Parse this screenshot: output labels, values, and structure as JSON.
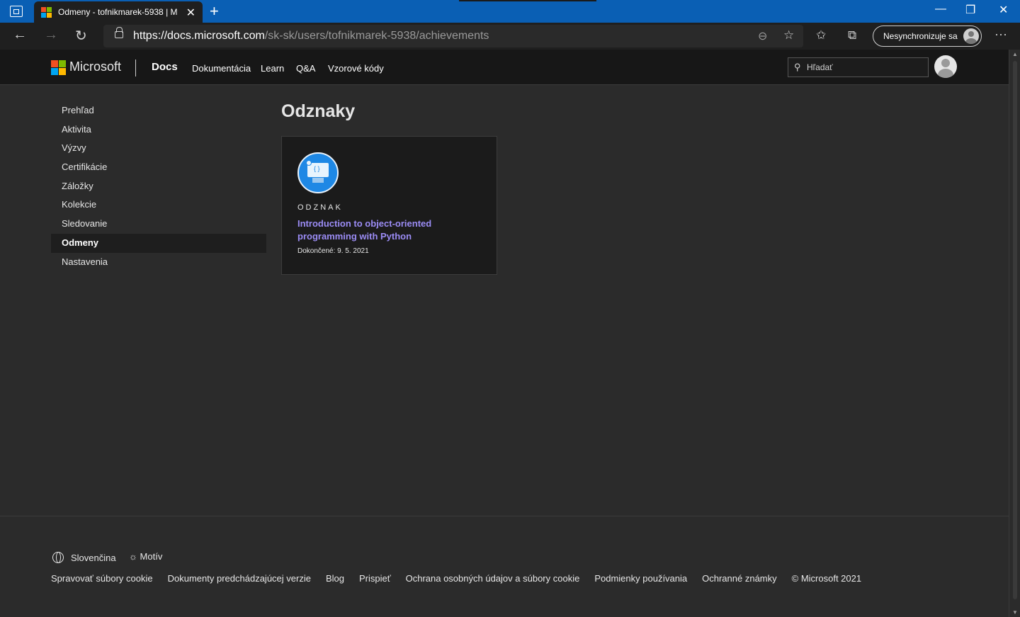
{
  "browser": {
    "tab_title": "Odmeny - tofnikmarek-5938 | M",
    "url_host": "https://docs.microsoft.com",
    "url_path": "/sk-sk/users/tofnikmarek-5938/achievements",
    "sync_label": "Nesynchronizuje sa",
    "tab_close": "✕",
    "new_tab": "+",
    "window_controls": [
      "—",
      "❐",
      "✕"
    ],
    "icons": [
      "back-icon",
      "forward-icon",
      "refresh-icon",
      "lock-icon",
      "zoom-icon",
      "add-favorite-icon",
      "favorites-icon",
      "collections-icon",
      "more-icon"
    ]
  },
  "header": {
    "brand": "Microsoft",
    "docs": "Docs",
    "nav": [
      "Dokumentácia",
      "Learn",
      "Q&A",
      "Vzorové kódy"
    ],
    "search_placeholder": "Hľadať"
  },
  "sidebar": {
    "items": [
      "Prehľad",
      "Aktivita",
      "Výzvy",
      "Certifikácie",
      "Záložky",
      "Kolekcie",
      "Sledovanie",
      "Odmeny",
      "Nastavenia"
    ],
    "active": "Odmeny"
  },
  "main": {
    "title": "Odznaky",
    "badges": [
      {
        "type": "ODZNAK",
        "title": "Introduction to object-oriented programming with Python",
        "completed": "Dokončené: 9. 5. 2021"
      }
    ]
  },
  "footer": {
    "language": "Slovenčina",
    "theme": "Motív",
    "links": [
      "Spravovať súbory cookie",
      "Dokumenty predchádzajúcej verzie",
      "Blog",
      "Prispieť",
      "Ochrana osobných údajov a súbory cookie",
      "Podmienky používania",
      "Ochranné známky",
      "© Microsoft 2021"
    ]
  },
  "colors": {
    "titlebar": "#0a5fb4",
    "link_purple": "#9b8cf5",
    "page_bg": "#2b2b2b",
    "header_bg": "#171717"
  }
}
